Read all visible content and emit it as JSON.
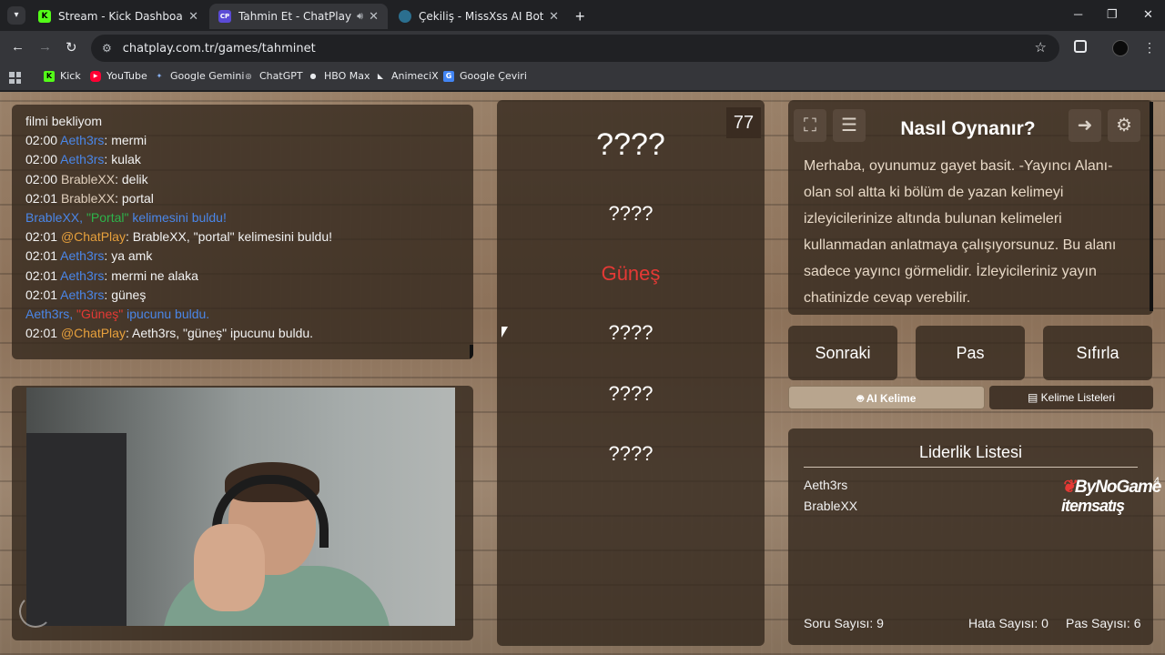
{
  "browser": {
    "tabs": [
      {
        "label": "Stream - Kick Dashboard",
        "favicon": "K"
      },
      {
        "label": "Tahmin Et - ChatPlay",
        "favicon": "CP"
      },
      {
        "label": "Çekiliş - MissXss AI Bot System",
        "favicon": ""
      }
    ],
    "url": "chatplay.com.tr/games/tahminet",
    "bookmarks": [
      {
        "label": "Kick",
        "icon": "K"
      },
      {
        "label": "YouTube",
        "icon": "▶"
      },
      {
        "label": "Google Gemini",
        "icon": "✦"
      },
      {
        "label": "ChatGPT",
        "icon": "◎"
      },
      {
        "label": "HBO Max",
        "icon": "●"
      },
      {
        "label": "AnimeciX",
        "icon": "◣"
      },
      {
        "label": "Google Çeviri",
        "icon": "G"
      }
    ]
  },
  "chat": {
    "lines": [
      {
        "text": "filmi bekliyom"
      },
      {
        "time": "02:00",
        "user": "Aeth3rs",
        "sep": ": ",
        "msg": "mermi"
      },
      {
        "time": "02:00",
        "user": "Aeth3rs",
        "sep": ": ",
        "msg": "kulak"
      },
      {
        "time": "02:00",
        "user": "BrableXX",
        "sep": ": ",
        "msg": "delik"
      },
      {
        "time": "02:01",
        "user": "BrableXX",
        "sep": ": ",
        "msg": "portal"
      },
      {
        "sys_user": "BrableXX, ",
        "sys_word": "\"Portal\"",
        "sys_rest": " kelimesini buldu!"
      },
      {
        "time": "02:01",
        "user": "@ChatPlay",
        "sep": ": ",
        "msg": "BrableXX, \"portal\" kelimesini buldu!"
      },
      {
        "time": "02:01",
        "user": "Aeth3rs",
        "sep": ": ",
        "msg": "ya amk"
      },
      {
        "time": "02:01",
        "user": "Aeth3rs",
        "sep": ": ",
        "msg": "mermi ne alaka"
      },
      {
        "time": "02:01",
        "user": "Aeth3rs",
        "sep": ": ",
        "msg": "güneş"
      },
      {
        "sys_user": "Aeth3rs, ",
        "sys_word": "\"Güneş\"",
        "sys_rest": " ipucunu buldu."
      },
      {
        "time": "02:01",
        "user": "@ChatPlay",
        "sep": ": ",
        "msg": "Aeth3rs, \"güneş\" ipucunu buldu."
      }
    ]
  },
  "game": {
    "counter": "77",
    "main_word": "????",
    "hints": [
      "????",
      "Güneş",
      "????",
      "????",
      "????"
    ]
  },
  "howto": {
    "title": "Nasıl Oynanır?",
    "text": "Merhaba, oyunumuz gayet basit. -Yayıncı Alanı- olan sol altta ki bölüm de yazan kelimeyi izleyicilerinize altında bulunan kelimeleri kullanmadan anlatmaya çalışıyorsunuz. Bu alanı sadece yayıncı görmelidir. İzleyicileriniz yayın chatinizde cevap verebilir."
  },
  "controls": {
    "next": "Sonraki",
    "pass": "Pas",
    "reset": "Sıfırla",
    "tab_ai": "AI Kelime",
    "tab_lists": "Kelime Listeleri"
  },
  "leaderboard": {
    "title": "Liderlik Listesi",
    "entries": [
      "Aeth3rs",
      "BrableXX"
    ],
    "question_count": "Soru Sayısı: 9",
    "error_count": "Hata Sayısı: 0",
    "pass_count": "Pas Sayısı: 6"
  },
  "overlay": {
    "brand_line1": "ByNoGame",
    "brand_line2": "itemsatış",
    "brand_badge": "4"
  },
  "colors": {
    "user_blue": "#4a86e8",
    "user_brown": "#e0cfbc",
    "bot_orange": "#e8a13c",
    "found_green": "#2db34a",
    "hint_red": "#e53935"
  }
}
